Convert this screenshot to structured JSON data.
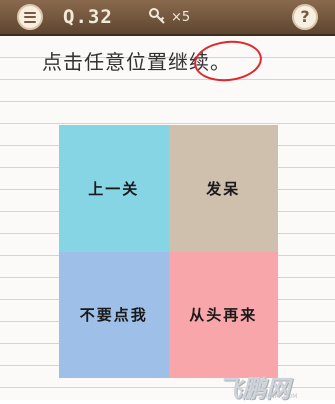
{
  "header": {
    "level": "Q.32",
    "keys_label": "×5",
    "help_label": "?"
  },
  "instruction": "点击任意位置继续。",
  "grid": {
    "cells": [
      "上一关",
      "发呆",
      "不要点我",
      "从头再来"
    ]
  },
  "watermark": {
    "text": "飞鹏网",
    "sub": "FPWAP.COM"
  },
  "colors": {
    "topbar": "#6f5239",
    "cell_cyan": "#86d5e4",
    "cell_tan": "#cfc0ae",
    "cell_blue": "#9dbfe8",
    "cell_pink": "#f9a6ab",
    "circle_red": "#e0282c"
  }
}
